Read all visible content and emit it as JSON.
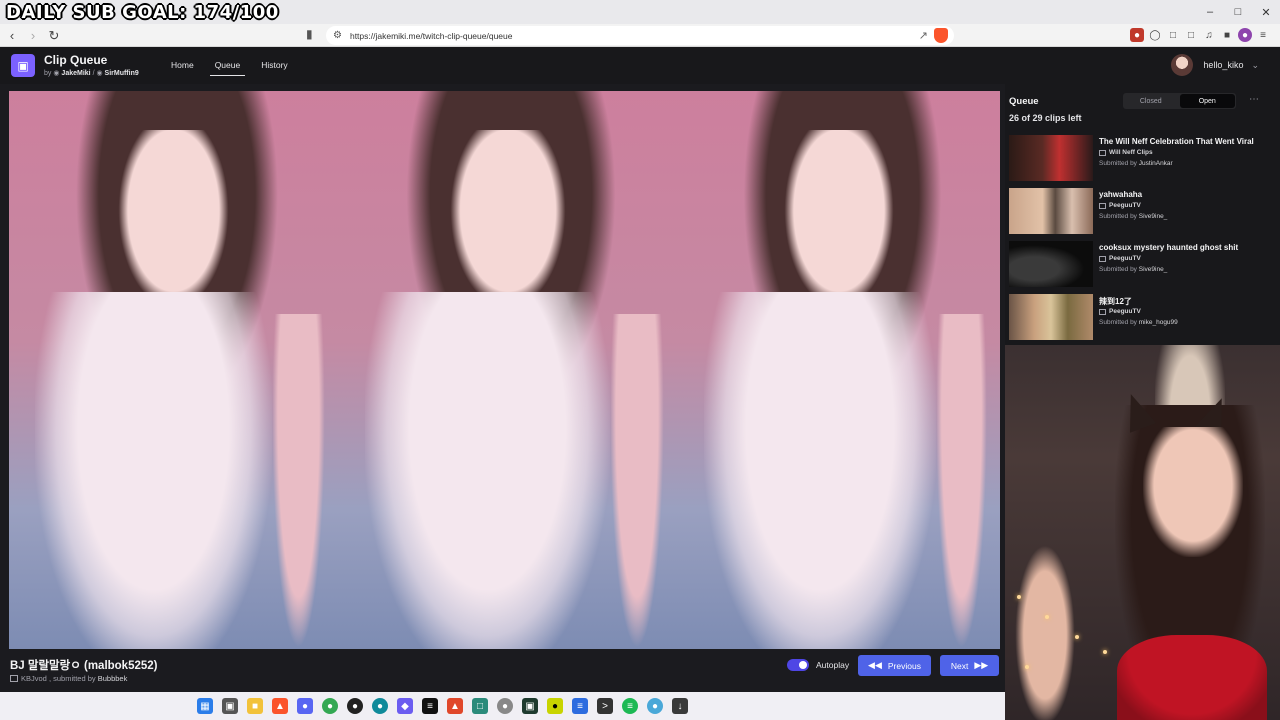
{
  "overlay": {
    "sub_goal": "DAILY SUB GOAL: 174/100"
  },
  "browser": {
    "url": "https://jakemiki.me/twitch-clip-queue/queue"
  },
  "app": {
    "title": "Clip Queue",
    "by_prefix": "by",
    "author1": "JakeMiki",
    "separator": "/",
    "author2": "SirMuffin9",
    "nav": [
      "Home",
      "Queue",
      "History"
    ],
    "active_nav": "Queue",
    "username": "hello_kiko"
  },
  "player": {
    "clip_title": "BJ 말랄말랑ㅇ (malbok5252)",
    "channel": "KBJvod",
    "submitted_prefix": ", submitted by",
    "submitter": "Bubbbek",
    "autoplay_label": "Autoplay",
    "autoplay_on": true,
    "previous_label": "Previous",
    "next_label": "Next"
  },
  "queue": {
    "title": "Queue",
    "toggle_closed": "Closed",
    "toggle_open": "Open",
    "count": "26 of 29 clips left",
    "submitted_prefix": "Submitted by",
    "items": [
      {
        "title": "The Will Neff Celebration That Went Viral",
        "channel": "Will Neff Clips",
        "submitter": "JustinAnkar"
      },
      {
        "title": "yahwahaha",
        "channel": "PeeguuTV",
        "submitter": "Sive9ine_"
      },
      {
        "title": "cooksux mystery haunted ghost shit",
        "channel": "PeeguuTV",
        "submitter": "Sive9ine_"
      },
      {
        "title": "辣到12了",
        "channel": "PeeguuTV",
        "submitter": "mike_hogu99"
      }
    ]
  },
  "colors": {
    "accent": "#4f63e8",
    "logo": "#7b61ff",
    "background": "#1b1b1f"
  },
  "icons": [
    "back-icon",
    "forward-icon",
    "reload-icon",
    "bookmark-icon",
    "share-icon",
    "brave-shield-icon",
    "more-icon"
  ]
}
